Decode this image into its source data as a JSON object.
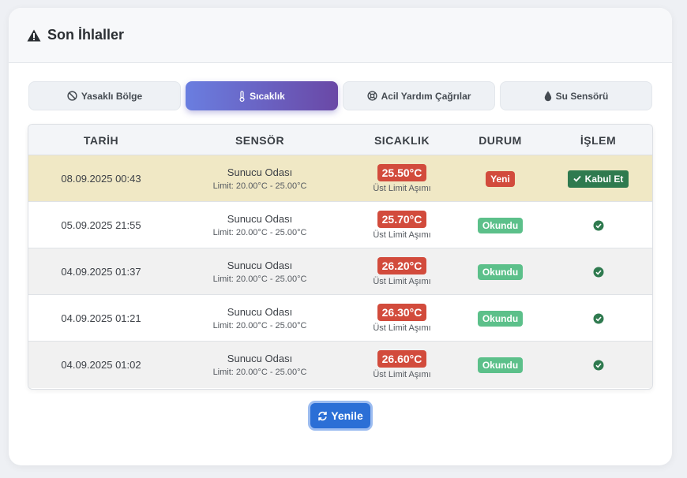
{
  "header": {
    "title": "Son İhlaller",
    "icon": "warning-icon"
  },
  "tabs": [
    {
      "label": "Yasaklı Bölge",
      "icon": "ban-icon",
      "active": false
    },
    {
      "label": "Sıcaklık",
      "icon": "thermometer-icon",
      "active": true
    },
    {
      "label": "Acil Yardım Çağrılar",
      "icon": "lifebuoy-icon",
      "active": false
    },
    {
      "label": "Su Sensörü",
      "icon": "droplet-icon",
      "active": false
    }
  ],
  "table": {
    "columns": [
      "TARİH",
      "SENSÖR",
      "SICAKLIK",
      "DURUM",
      "İŞLEM"
    ],
    "rows": [
      {
        "date": "08.09.2025 00:43",
        "sensor": "Sunucu Odası",
        "limit": "Limit: 20.00°C - 25.00°C",
        "temp": "25.50°C",
        "temp_note": "Üst Limit Aşımı",
        "status": "Yeni",
        "action": "Kabul Et"
      },
      {
        "date": "05.09.2025 21:55",
        "sensor": "Sunucu Odası",
        "limit": "Limit: 20.00°C - 25.00°C",
        "temp": "25.70°C",
        "temp_note": "Üst Limit Aşımı",
        "status": "Okundu",
        "action": "check-circle-icon"
      },
      {
        "date": "04.09.2025 01:37",
        "sensor": "Sunucu Odası",
        "limit": "Limit: 20.00°C - 25.00°C",
        "temp": "26.20°C",
        "temp_note": "Üst Limit Aşımı",
        "status": "Okundu",
        "action": "check-circle-icon"
      },
      {
        "date": "04.09.2025 01:21",
        "sensor": "Sunucu Odası",
        "limit": "Limit: 20.00°C - 25.00°C",
        "temp": "26.30°C",
        "temp_note": "Üst Limit Aşımı",
        "status": "Okundu",
        "action": "check-circle-icon"
      },
      {
        "date": "04.09.2025 01:02",
        "sensor": "Sunucu Odası",
        "limit": "Limit: 20.00°C - 25.00°C",
        "temp": "26.60°C",
        "temp_note": "Üst Limit Aşımı",
        "status": "Okundu",
        "action": "check-circle-icon"
      }
    ]
  },
  "refresh_label": "Yenile",
  "colors": {
    "accent": "#6a7ee0",
    "danger": "#d24b3c",
    "success": "#5cc08a",
    "accept": "#2f7a4f",
    "highlight_row": "#f0e8c5",
    "refresh": "#2b6fd6"
  }
}
